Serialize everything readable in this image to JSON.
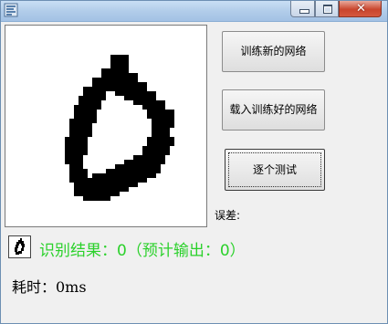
{
  "window": {
    "title": "",
    "app_icon": "app-icon",
    "controls": {
      "minimize_icon": "minimize-icon",
      "maximize_icon": "maximize-icon",
      "close_icon": "close-icon",
      "close_glyph": "✕"
    }
  },
  "drawing_canvas": {
    "digit_drawn": "0",
    "stroke_color": "#000000",
    "background_color": "#ffffff"
  },
  "buttons": {
    "train_label": "训练新的网络",
    "load_label": "载入训练好的网络",
    "test_label": "逐个测试"
  },
  "error": {
    "label": "误差:",
    "value": ""
  },
  "result": {
    "text": "识别结果：0（预计输出：0）",
    "color": "#2bd12b"
  },
  "timing": {
    "text": "耗时：0ms"
  }
}
